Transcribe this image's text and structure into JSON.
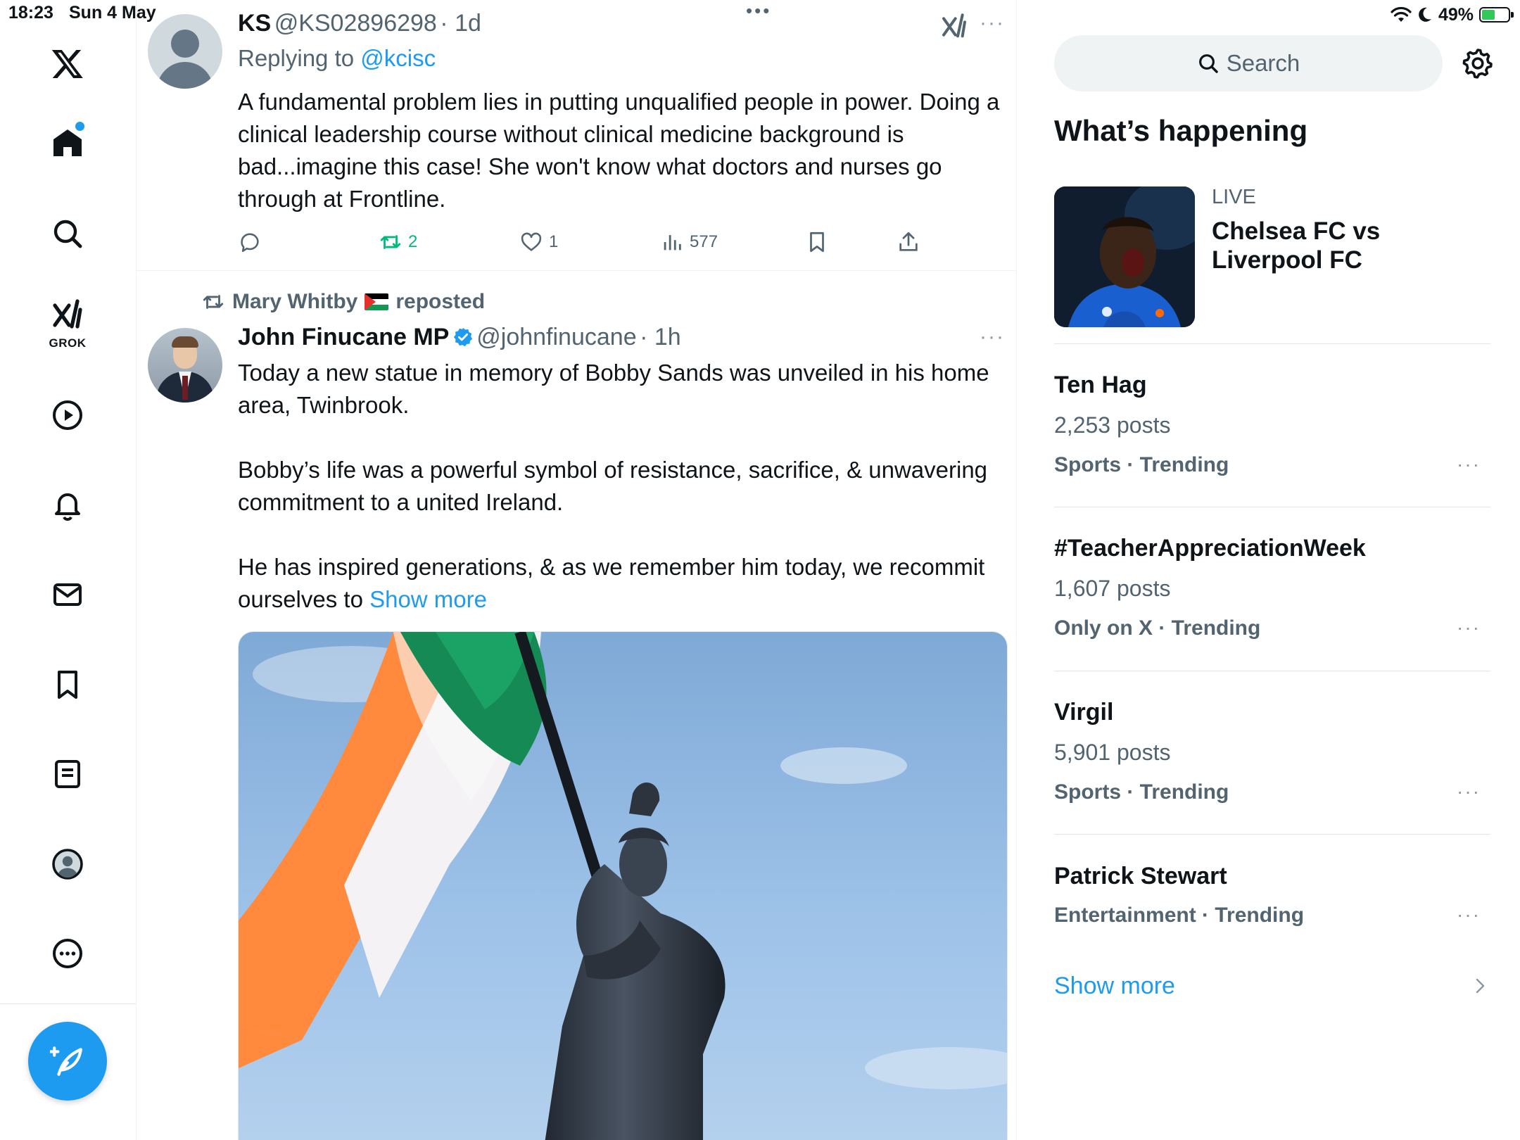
{
  "status_bar": {
    "time": "18:23",
    "date": "Sun 4 May",
    "battery": "49%",
    "battery_level": 0.49
  },
  "sidebar": {
    "grok_label": "GROK"
  },
  "tweet1": {
    "name": "KS",
    "handle": "@KS02896298",
    "time": "· 1d",
    "replying_prefix": "Replying to ",
    "replying_to": "@kcisc",
    "text": "A fundamental problem lies in putting unqualified people in power. Doing a clinical leadership course without clinical medicine background is bad...imagine this case! She won't know what doctors and nurses go through at Frontline.",
    "retweets": "2",
    "likes": "1",
    "views": "577",
    "more": "···",
    "top_dots": "•••"
  },
  "tweet2": {
    "reposted_by": "Mary Whitby",
    "reposted_suffix": "reposted",
    "name": "John Finucane MP",
    "handle": "@johnfinucane",
    "time": "· 1h",
    "para1": "Today a new statue in memory of Bobby Sands was unveiled in his home area, Twinbrook.",
    "para2": "Bobby’s life was a powerful symbol of resistance, sacrifice, & unwavering commitment to a united Ireland.",
    "para3": "He has inspired generations, & as we remember him today, we recommit ourselves to ",
    "show_more": "Show more",
    "more": "···"
  },
  "right": {
    "search_placeholder": "Search",
    "section_title": "What’s happening",
    "news": {
      "badge": "LIVE",
      "title": "Chelsea FC vs Liverpool FC"
    },
    "trends": [
      {
        "name": "Ten Hag",
        "posts": "2,253 posts",
        "category": "Sports · Trending"
      },
      {
        "name": "#TeacherAppreciationWeek",
        "posts": "1,607 posts",
        "category": "Only on X · Trending"
      },
      {
        "name": "Virgil",
        "posts": "5,901 posts",
        "category": "Sports · Trending"
      },
      {
        "name": "Patrick Stewart",
        "posts": "",
        "category": "Entertainment · Trending"
      }
    ],
    "trend_more": "···",
    "show_more": "Show more"
  },
  "colors": {
    "accent": "#1d9bf0",
    "retweet_green": "#00ba7c",
    "text_primary": "#0f1419",
    "text_secondary": "#536471"
  },
  "icons": [
    "x-logo-icon",
    "home-icon",
    "search-icon",
    "grok-icon",
    "video-icon",
    "bell-icon",
    "mail-icon",
    "bookmark-icon",
    "list-icon",
    "profile-icon",
    "more-circle-icon",
    "compose-icon",
    "reply-icon",
    "retweet-icon",
    "like-icon",
    "views-icon",
    "share-icon",
    "settings-icon",
    "verified-icon",
    "wifi-icon",
    "moon-icon",
    "battery-icon"
  ]
}
